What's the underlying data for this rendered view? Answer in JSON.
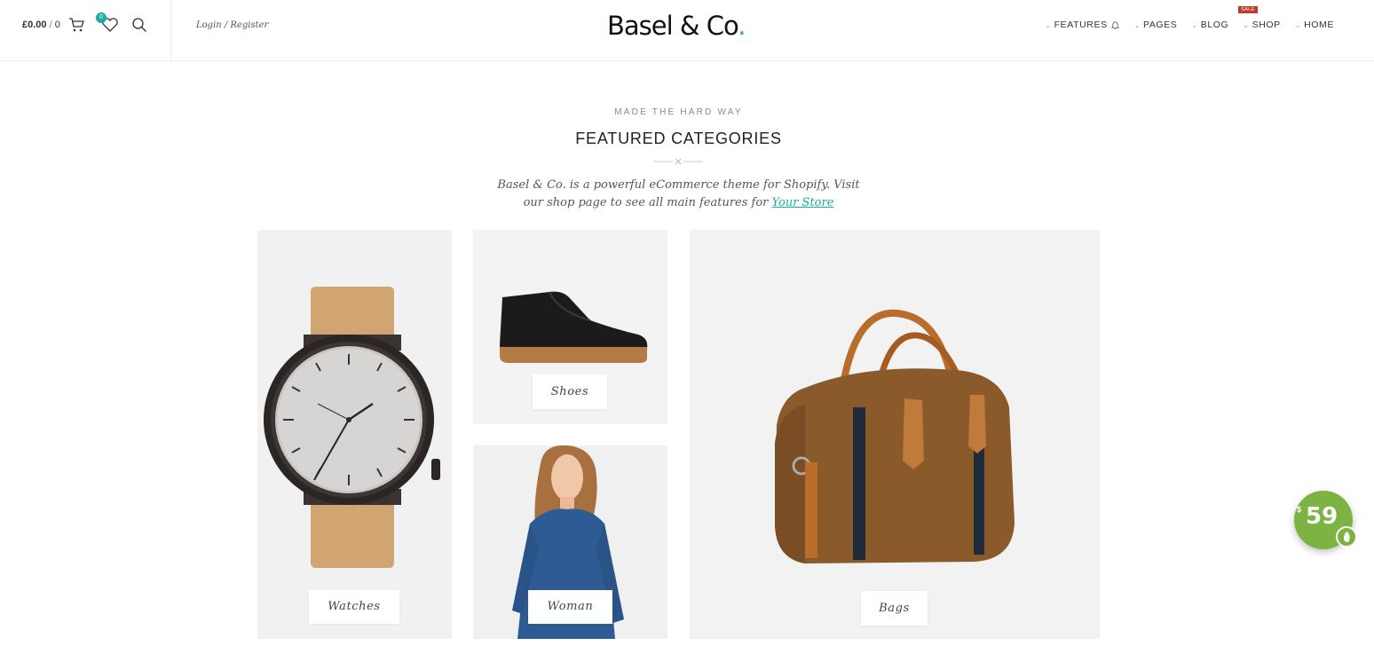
{
  "header": {
    "cart_total": "£0.00",
    "cart_sep": "/",
    "cart_count": "0",
    "wishlist_count": "0",
    "login_label": "Login / Register",
    "logo_text": "Basel & Co",
    "logo_dot": ".",
    "nav": [
      {
        "label": "FEATURES",
        "icon": "bell-icon"
      },
      {
        "label": "PAGES"
      },
      {
        "label": "BLOG"
      },
      {
        "label": "SHOP",
        "badge": "SALE"
      },
      {
        "label": "HOME"
      }
    ],
    "icons": [
      "cart-icon",
      "heart-icon",
      "search-icon",
      "chevron-down-icon"
    ]
  },
  "section": {
    "eyebrow": "MADE THE HARD WAY",
    "title": "FEATURED CATEGORIES",
    "intro_line1": "Basel & Co. is a powerful eCommerce theme for Shopify. Visit",
    "intro_line2": "our shop page to see all main features for",
    "intro_link": "Your Store"
  },
  "categories": [
    {
      "label": "Watches"
    },
    {
      "label": "Shoes"
    },
    {
      "label": "Woman"
    },
    {
      "label": "Bags"
    }
  ],
  "promo": {
    "currency": "$",
    "price": "59"
  },
  "colors": {
    "accent": "#1aada3",
    "sale": "#c0392b",
    "promo": "#7cb342"
  }
}
